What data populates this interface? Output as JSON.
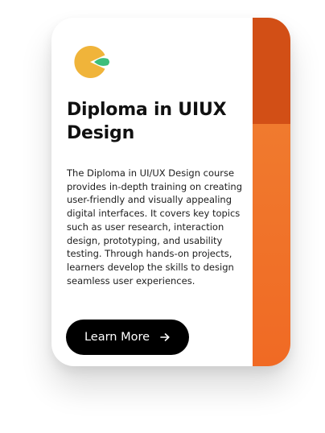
{
  "card": {
    "title": "Diploma in UIUX Design",
    "description": "The Diploma in UI/UX Design course provides in-depth training on creating user-friendly and visually appealing digital interfaces. It covers key topics such as user research, interaction design, prototyping, and usability testing. Through hands-on projects, learners develop the skills to design seamless user experiences.",
    "button_label": "Learn More",
    "button_icon": "arrow-right-icon",
    "logo_icon": "pie-chart-logo-icon"
  },
  "colors": {
    "accent_top": "#D24F16",
    "accent_bottom": "#F07A2E",
    "logo_yellow": "#F0B43A",
    "logo_green": "#3DBE7A",
    "button_bg": "#000000"
  }
}
